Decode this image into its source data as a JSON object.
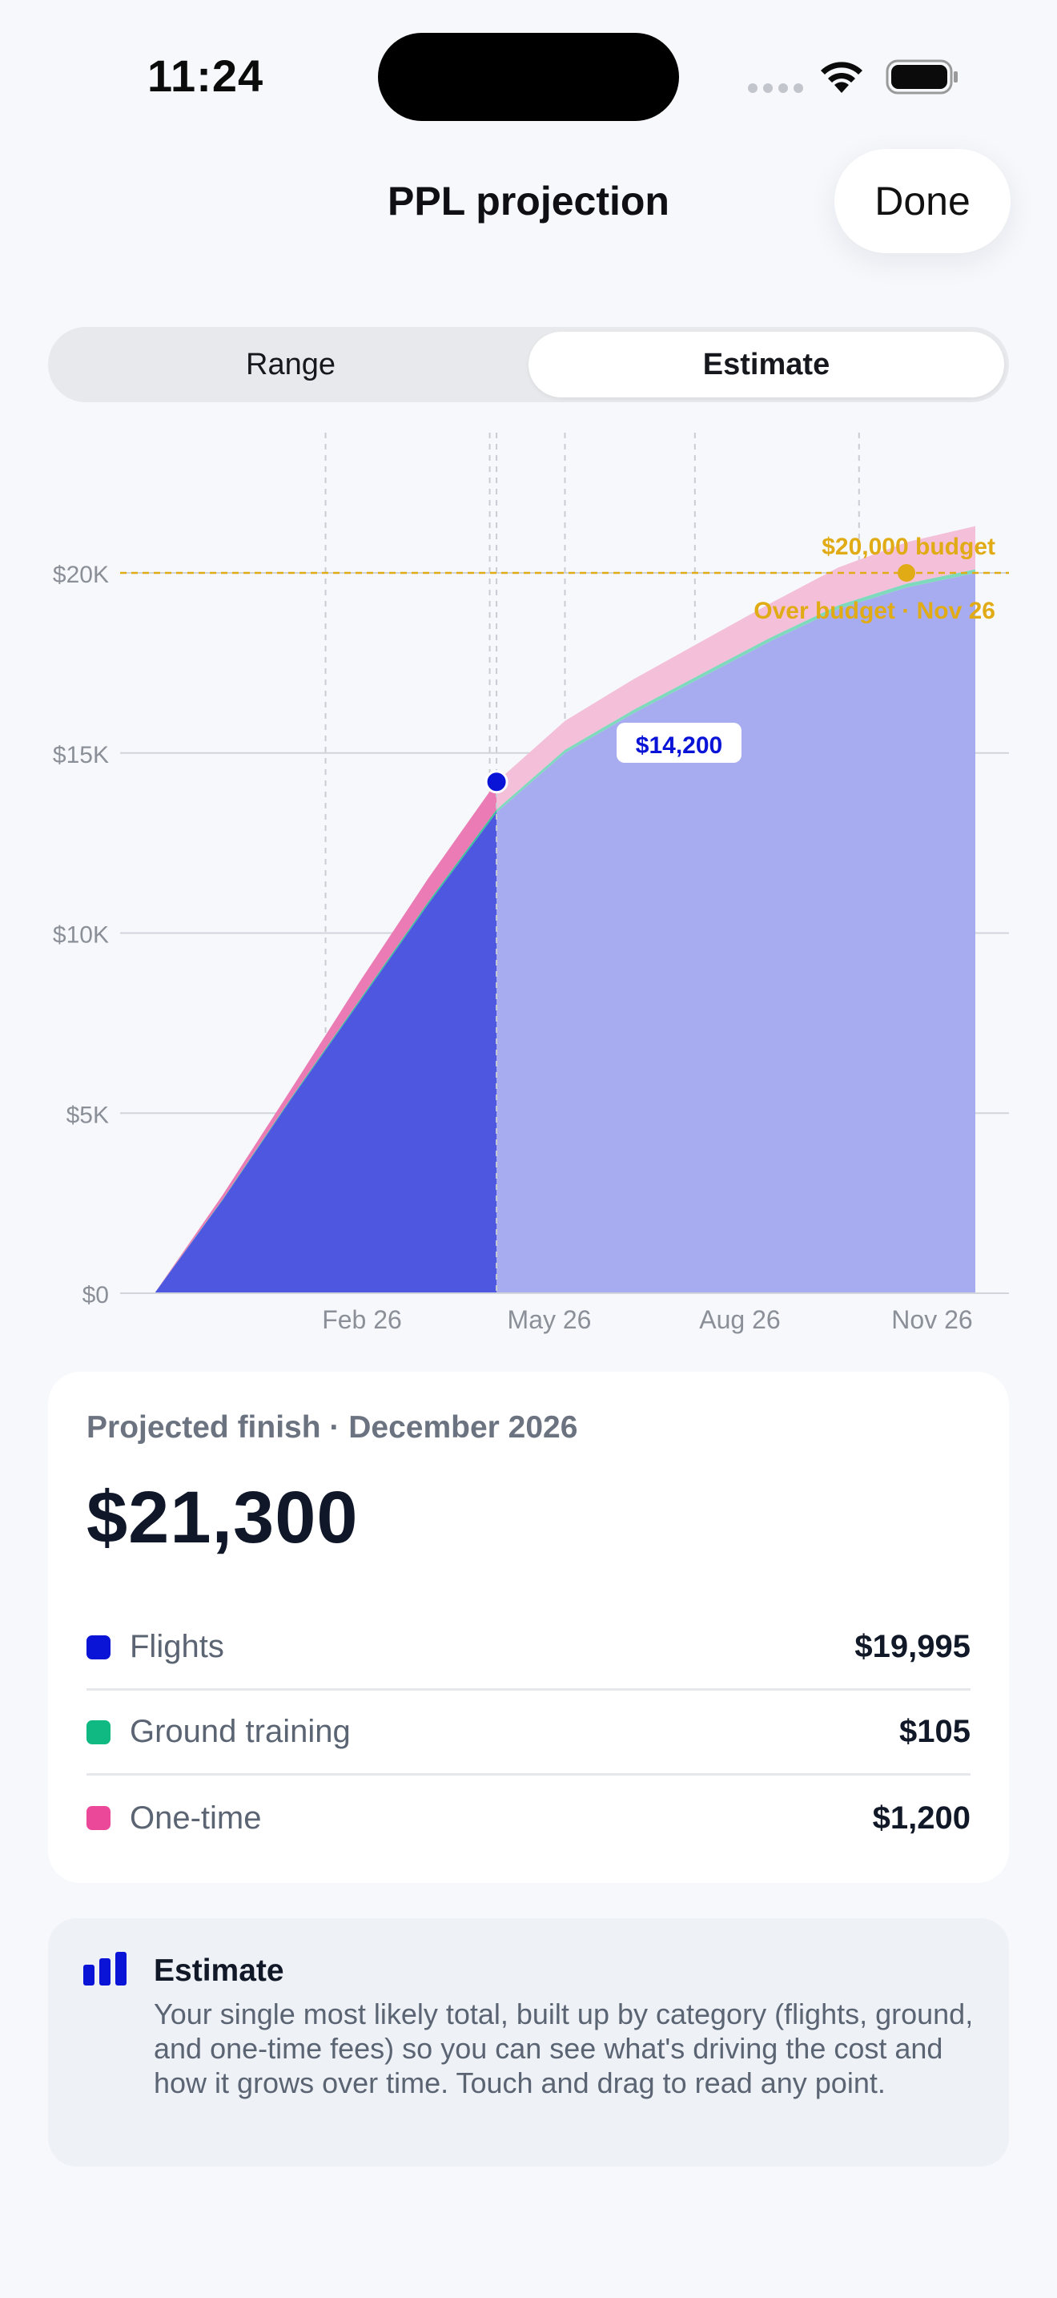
{
  "status": {
    "time": "11:24"
  },
  "header": {
    "title": "PPL projection",
    "done_label": "Done"
  },
  "segmented": {
    "options": [
      "Range",
      "Estimate"
    ],
    "selected": "Estimate"
  },
  "chart_data": {
    "type": "area",
    "stacked": true,
    "x_ticks": [
      "Feb 26",
      "May 26",
      "Aug 26",
      "Nov 26"
    ],
    "y_ticks": [
      "$0",
      "$5K",
      "$10K",
      "$15K",
      "$20K"
    ],
    "ylim": [
      0,
      24000
    ],
    "x_months": [
      "Dec 25",
      "Jan 26",
      "Feb 26",
      "Mar 26",
      "Apr 26",
      "May 26",
      "Jun 26",
      "Jul 26",
      "Aug 26",
      "Sep 26",
      "Oct 26",
      "Nov 26",
      "Dec 26"
    ],
    "series": [
      {
        "name": "Flights",
        "color": "#0a14d6",
        "values": [
          0,
          2600,
          5400,
          8100,
          10800,
          13350,
          15000,
          16100,
          17100,
          18100,
          19000,
          19600,
          19995
        ]
      },
      {
        "name": "Ground training",
        "color": "#10b981",
        "values": [
          0,
          20,
          35,
          50,
          65,
          80,
          90,
          95,
          100,
          102,
          104,
          105,
          105
        ]
      },
      {
        "name": "One-time",
        "color": "#ec4899",
        "values": [
          0,
          120,
          240,
          500,
          650,
          770,
          800,
          850,
          900,
          950,
          1050,
          1150,
          1200
        ]
      }
    ],
    "actual_through": "May 26",
    "budget": {
      "value": 20000,
      "label": "$20,000 budget",
      "status": "Over budget · Nov 26",
      "color": "#e0ab14"
    },
    "marker": {
      "x": "May 26",
      "value": 14200,
      "label": "$14,200"
    }
  },
  "summary": {
    "subtitle": "Projected finish · December 2026",
    "total": "$21,300",
    "rows": [
      {
        "label": "Flights",
        "value": "$19,995",
        "color": "#0a14d6"
      },
      {
        "label": "Ground training",
        "value": "$105",
        "color": "#10b981"
      },
      {
        "label": "One-time",
        "value": "$1,200",
        "color": "#ec4899"
      }
    ]
  },
  "info": {
    "icon": "bar-chart-icon",
    "title": "Estimate",
    "body": "Your single most likely total, built up by category (flights, ground, and one-time fees) so you can see what's driving the cost and how it grows over time. Touch and drag to read any point."
  }
}
